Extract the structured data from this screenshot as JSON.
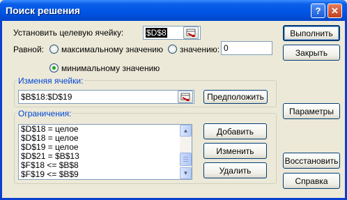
{
  "window": {
    "title": "Поиск решения",
    "help_symbol": "?",
    "close_symbol": "✕"
  },
  "target": {
    "label": "Установить целевую ячейку:",
    "value": "$D$8"
  },
  "equal_to": {
    "label": "Равной:",
    "options": [
      {
        "label": "максимальному значению",
        "checked": false
      },
      {
        "label": "значению:",
        "checked": false
      },
      {
        "label": "минимальному значению",
        "checked": true
      }
    ],
    "value_field": "0"
  },
  "changing": {
    "label": "Изменяя ячейки:",
    "value": "$B$18:$D$19",
    "guess_button": "Предположить"
  },
  "constraints": {
    "label": "Ограничения:",
    "items": [
      "$D$18 = целое",
      "$D$18 = целое",
      "$D$19 = целое",
      "$D$21 = $B$13",
      "$F$18 <= $B$8",
      "$F$19 <= $B$9"
    ],
    "add_button": "Добавить",
    "change_button": "Изменить",
    "delete_button": "Удалить"
  },
  "side_buttons": {
    "solve": "Выполнить",
    "close": "Закрыть",
    "options": "Параметры",
    "reset": "Восстановить",
    "help": "Справка"
  }
}
